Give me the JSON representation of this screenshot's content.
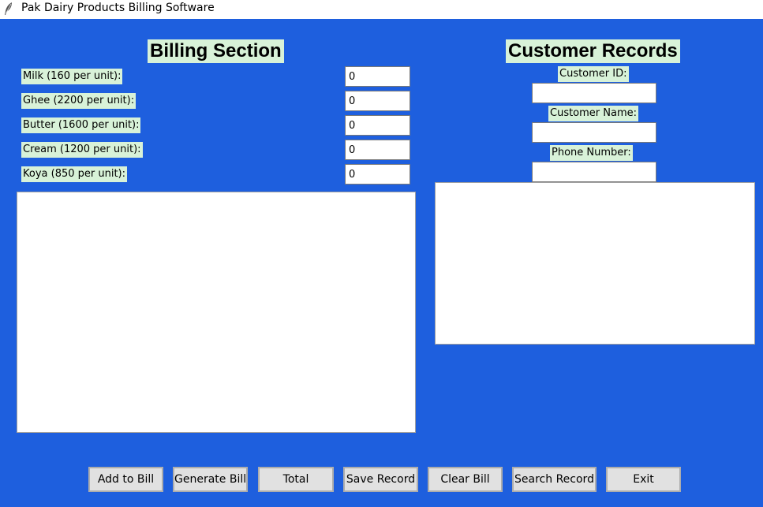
{
  "window": {
    "title": "Pak Dairy Products Billing Software",
    "icon": "feather-icon"
  },
  "billing": {
    "heading": "Billing Section",
    "items": [
      {
        "label": "Milk (160 per unit):",
        "value": "0"
      },
      {
        "label": "Ghee (2200 per unit):",
        "value": "0"
      },
      {
        "label": "Butter (1600 per unit):",
        "value": "0"
      },
      {
        "label": "Cream (1200 per unit):",
        "value": "0"
      },
      {
        "label": "Koya (850 per unit):",
        "value": "0"
      }
    ]
  },
  "customer": {
    "heading": "Customer Records",
    "id_label": "Customer ID:",
    "name_label": "Customer Name:",
    "phone_label": "Phone Number:",
    "id_value": "",
    "name_value": "",
    "phone_value": ""
  },
  "buttons": {
    "add": "Add to Bill",
    "generate": "Generate Bill",
    "total": "Total",
    "save": "Save Record",
    "clear": "Clear Bill",
    "search": "Search Record",
    "exit": "Exit"
  },
  "colors": {
    "background": "#1e5fde",
    "label_bg": "#d8f2d8",
    "button_bg": "#e1e1e1"
  }
}
